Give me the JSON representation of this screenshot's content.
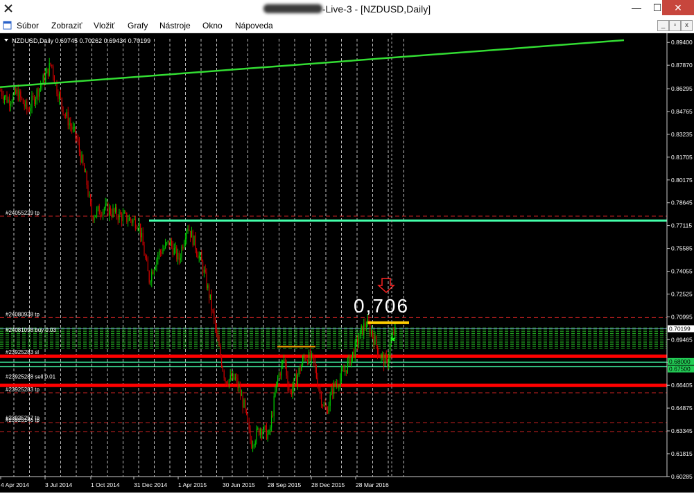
{
  "window": {
    "title_suffix": "-Live-3 - [NZDUSD,Daily]",
    "controls": {
      "minimize": "—",
      "maximize": "☐",
      "close": "✕"
    }
  },
  "menu": {
    "items": [
      {
        "label": "Súbor"
      },
      {
        "label": "Zobraziť"
      },
      {
        "label": "Vložiť"
      },
      {
        "label": "Grafy"
      },
      {
        "label": "Nástroje"
      },
      {
        "label": "Okno"
      },
      {
        "label": "Nápoveda"
      }
    ],
    "mdi": {
      "minimize": "_",
      "restore": "▫",
      "close": "x"
    }
  },
  "colors": {
    "background": "#000000",
    "up_candle": "#00cc00",
    "down_candle": "#cc0000",
    "grid": "#ffffff",
    "trendline": "#33dd33",
    "support": "#44ffaa",
    "red_line": "#ff0000",
    "orange": "#ffaa00",
    "yellow": "#ffcc00",
    "axis_text": "#ffffff"
  },
  "chart": {
    "symbol_info": "NZDUSD,Daily  0.69745 0.70262 0.69434 0.70199",
    "big_label": "0,706",
    "y_ticks": [
      "0.89400",
      "0.87870",
      "0.86295",
      "0.84765",
      "0.83235",
      "0.81705",
      "0.80175",
      "0.78645",
      "0.77115",
      "0.75585",
      "0.74055",
      "0.72525",
      "0.70995",
      "0.69465",
      "0.67935",
      "0.66405",
      "0.64875",
      "0.63345",
      "0.61815",
      "0.60285"
    ],
    "price_tags": [
      {
        "label": "0.70199",
        "kind": "current"
      },
      {
        "label": "0.68000",
        "kind": "green"
      },
      {
        "label": "0.67500",
        "kind": "green"
      }
    ],
    "x_ticks": [
      "4 Apr 2014",
      "3 Jul 2014",
      "1 Oct 2014",
      "31 Dec 2014",
      "1 Apr 2015",
      "30 Jun 2015",
      "28 Sep 2015",
      "28 Dec 2015",
      "28 Mar 2016"
    ],
    "order_labels": [
      "#24055229 tp",
      "#24080938 tp",
      "#24081098 buy 0.03",
      "#23925283 sl",
      "#23925288 sell 0.01",
      "#23925283 tp",
      "#23925257 tp",
      "#23925146 tp"
    ]
  },
  "chart_data": {
    "type": "candlestick",
    "title": "NZDUSD,Daily",
    "x_ticks": [
      "4 Apr 2014",
      "3 Jul 2014",
      "1 Oct 2014",
      "31 Dec 2014",
      "1 Apr 2015",
      "30 Jun 2015",
      "28 Sep 2015",
      "28 Dec 2015",
      "28 Mar 2016"
    ],
    "ylim": [
      0.6028,
      0.8955
    ],
    "last_ohlc": {
      "open": 0.69745,
      "high": 0.70262,
      "low": 0.69434,
      "close": 0.70199
    },
    "path_points": [
      [
        0,
        0.862
      ],
      [
        12,
        0.855
      ],
      [
        25,
        0.86
      ],
      [
        40,
        0.848
      ],
      [
        55,
        0.862
      ],
      [
        66,
        0.872
      ],
      [
        74,
        0.88
      ],
      [
        80,
        0.866
      ],
      [
        92,
        0.848
      ],
      [
        110,
        0.83
      ],
      [
        125,
        0.8
      ],
      [
        132,
        0.778
      ],
      [
        150,
        0.783
      ],
      [
        172,
        0.778
      ],
      [
        200,
        0.773
      ],
      [
        215,
        0.735
      ],
      [
        228,
        0.752
      ],
      [
        245,
        0.76
      ],
      [
        258,
        0.748
      ],
      [
        270,
        0.772
      ],
      [
        280,
        0.76
      ],
      [
        292,
        0.744
      ],
      [
        303,
        0.722
      ],
      [
        315,
        0.69
      ],
      [
        325,
        0.668
      ],
      [
        340,
        0.668
      ],
      [
        352,
        0.65
      ],
      [
        362,
        0.625
      ],
      [
        376,
        0.636
      ],
      [
        388,
        0.63
      ],
      [
        400,
        0.668
      ],
      [
        410,
        0.682
      ],
      [
        418,
        0.658
      ],
      [
        430,
        0.672
      ],
      [
        440,
        0.684
      ],
      [
        452,
        0.68
      ],
      [
        462,
        0.658
      ],
      [
        470,
        0.645
      ],
      [
        480,
        0.662
      ],
      [
        495,
        0.672
      ],
      [
        508,
        0.684
      ],
      [
        520,
        0.699
      ],
      [
        528,
        0.706
      ],
      [
        536,
        0.7
      ],
      [
        548,
        0.684
      ],
      [
        558,
        0.678
      ],
      [
        565,
        0.696
      ],
      [
        570,
        0.702
      ]
    ],
    "levels": {
      "green_upper": 0.7745,
      "red_upper": 0.6835,
      "green_mid_1": 0.6795,
      "green_mid_2": 0.6765,
      "red_lower": 0.664,
      "yellow_bar": 0.706
    }
  }
}
